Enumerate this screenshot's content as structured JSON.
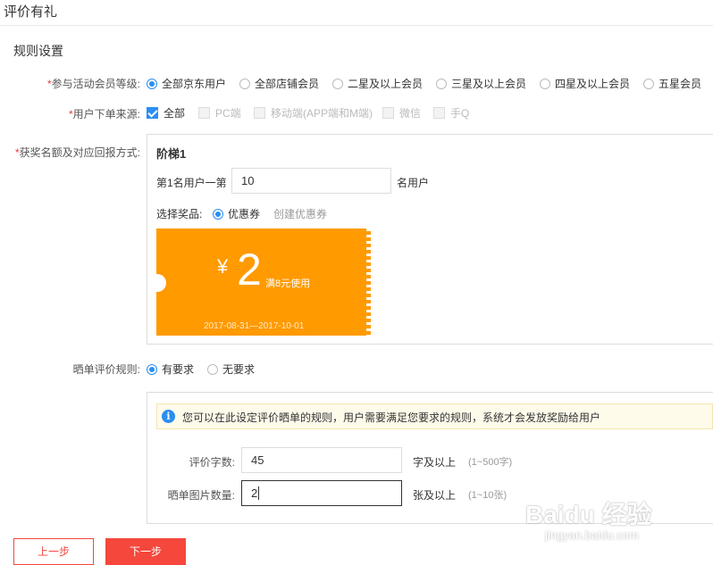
{
  "page": {
    "title": "评价有礼"
  },
  "rules": {
    "section_title": "规则设置",
    "member_level": {
      "required_mark": "*",
      "label": "参与活动会员等级:",
      "options": [
        "全部京东用户",
        "全部店铺会员",
        "二星及以上会员",
        "三星及以上会员",
        "四星及以上会员",
        "五星会员"
      ],
      "selected": "全部京东用户"
    },
    "order_source": {
      "required_mark": "*",
      "label": "用户下单来源:",
      "options": [
        "全部",
        "PC端",
        "移动端(APP端和M端)",
        "微信",
        "手Q"
      ],
      "checked": "全部"
    },
    "prize": {
      "required_mark": "*",
      "label": "获奖名额及对应回报方式:",
      "tier_title": "阶梯1",
      "rank_prefix": "第1名用户一第",
      "rank_value": "10",
      "rank_suffix": "名用户",
      "select_prize_label": "选择奖品:",
      "prize_option": "优惠券",
      "create_coupon_link": "创建优惠券",
      "coupon": {
        "currency": "¥",
        "amount": "2",
        "condition": "满8元使用",
        "validity": "2017-08-31—2017-10-01",
        "color": "#ff9a00"
      }
    },
    "review_rule": {
      "label": "晒单评价规则:",
      "options": [
        "有要求",
        "无要求"
      ],
      "selected": "有要求",
      "info_text": "您可以在此设定评价晒单的规则，用户需要满足您要求的规则，系统才会发放奖励给用户",
      "word_count": {
        "label": "评价字数:",
        "value": "45",
        "suffix": "字及以上",
        "hint": "(1~500字)"
      },
      "image_count": {
        "label": "晒单图片数量:",
        "value": "2",
        "suffix": "张及以上",
        "hint": "(1~10张)"
      }
    }
  },
  "buttons": {
    "prev": "上一步",
    "next": "下一步"
  },
  "watermark": {
    "brand": "Baidu 经验",
    "url": "jingyan.baidu.com"
  },
  "colors": {
    "accent": "#2a8ef3",
    "danger": "#f5473c",
    "coupon": "#ff9a00"
  }
}
